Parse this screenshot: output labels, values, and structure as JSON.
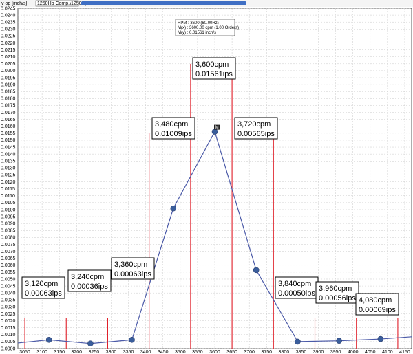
{
  "toolbar": {
    "unit_label": "v op [inch/s]",
    "channel_label": "1250Hp Comp.\\1250Hp"
  },
  "info_box": {
    "line1": "RPM : 3600 (60.00Hz)",
    "line2": "M(x) : 3600.00 cpm (1.00 Orders)",
    "line3": "M(y) : 0.01561 inch/s"
  },
  "marker_label": "M",
  "colors": {
    "series": "#4b5aa8",
    "points": "#3a5e9c",
    "markers": "#e0202a",
    "grid": "#c8c8c8",
    "titlebar": "#3f6fc4"
  },
  "chart_data": {
    "type": "line",
    "xlim": [
      3030,
      4170
    ],
    "ylim": [
      0,
      0.0245
    ],
    "ylabel": "v op [inch/s]",
    "grid": true,
    "y_tick_step": 0.0005,
    "x_ticks": [
      3050,
      3100,
      3150,
      3200,
      3250,
      3300,
      3350,
      3400,
      3450,
      3500,
      3550,
      3600,
      3650,
      3700,
      3750,
      3800,
      3850,
      3900,
      3950,
      4000,
      4050,
      4100,
      4150
    ],
    "series": [
      {
        "x": [
          3030,
          3120,
          3240,
          3360,
          3480,
          3600,
          3720,
          3840,
          3960,
          4080,
          4170
        ],
        "y": [
          0.0004,
          0.00063,
          0.00036,
          0.00063,
          0.01009,
          0.01561,
          0.00565,
          0.0005,
          0.00056,
          0.00069,
          0.00085
        ]
      }
    ],
    "points": [
      {
        "x": 3120,
        "y": 0.00063
      },
      {
        "x": 3240,
        "y": 0.00036
      },
      {
        "x": 3360,
        "y": 0.00063
      },
      {
        "x": 3480,
        "y": 0.01009
      },
      {
        "x": 3600,
        "y": 0.01561
      },
      {
        "x": 3720,
        "y": 0.00565
      },
      {
        "x": 3840,
        "y": 0.0005
      },
      {
        "x": 3960,
        "y": 0.00056
      },
      {
        "x": 4080,
        "y": 0.00069
      }
    ],
    "marker_lines": [
      {
        "x": 3050,
        "top": 0.0022
      },
      {
        "x": 3170,
        "top": 0.0022
      },
      {
        "x": 3290,
        "top": 0.0022
      },
      {
        "x": 3410,
        "top": 0.0155
      },
      {
        "x": 3530,
        "top": 0.0205
      },
      {
        "x": 3650,
        "top": 0.0205
      },
      {
        "x": 3770,
        "top": 0.0155
      },
      {
        "x": 3890,
        "top": 0.0022
      },
      {
        "x": 4010,
        "top": 0.0022
      },
      {
        "x": 4130,
        "top": 0.0022
      }
    ],
    "annotations": [
      {
        "x": 3120,
        "cpm": "3,120cpm",
        "ips": "0.00063ips"
      },
      {
        "x": 3240,
        "cpm": "3,240cpm",
        "ips": "0.00036ips"
      },
      {
        "x": 3360,
        "cpm": "3,360cpm",
        "ips": "0.00063ips"
      },
      {
        "x": 3480,
        "cpm": "3,480cpm",
        "ips": "0.01009ips"
      },
      {
        "x": 3600,
        "cpm": "3,600cpm",
        "ips": "0.01561ips"
      },
      {
        "x": 3720,
        "cpm": "3,720cpm",
        "ips": "0.00565ips"
      },
      {
        "x": 3840,
        "cpm": "3,840cpm",
        "ips": "0.00050ips"
      },
      {
        "x": 3960,
        "cpm": "3,960cpm",
        "ips": "0.00056ips"
      },
      {
        "x": 4080,
        "cpm": "4,080cpm",
        "ips": "0.00069ips"
      }
    ]
  }
}
